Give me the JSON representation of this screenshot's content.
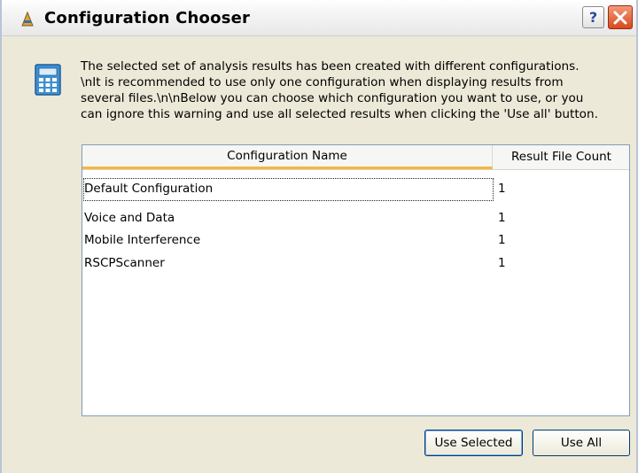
{
  "window": {
    "title": "Configuration Chooser",
    "help_label": "?",
    "title_icon": "app-icon",
    "close_icon": "close-icon"
  },
  "message": {
    "icon": "calculator-icon",
    "lines": [
      "The selected set of analysis results has been created with different configurations.",
      "\\nIt is recommended to use only one configuration when displaying results from",
      "several files.\\n\\nBelow you can choose which configuration you want to use, or you",
      "can ignore this warning and use all selected results when clicking the 'Use all' button."
    ]
  },
  "list": {
    "columns": [
      "Configuration Name",
      "Result File Count"
    ],
    "rows": [
      {
        "name": "Default Configuration",
        "count": "1"
      },
      {
        "name": "Voice and Data",
        "count": "1"
      },
      {
        "name": "Mobile Interference",
        "count": "1"
      },
      {
        "name": "RSCPScanner",
        "count": "1"
      }
    ]
  },
  "buttons": {
    "use_selected": "Use Selected",
    "use_all": "Use All"
  },
  "colors": {
    "dialog_bg": "#ece9d8",
    "sort_accent": "#f5b740",
    "close_red": "#d8491c"
  }
}
